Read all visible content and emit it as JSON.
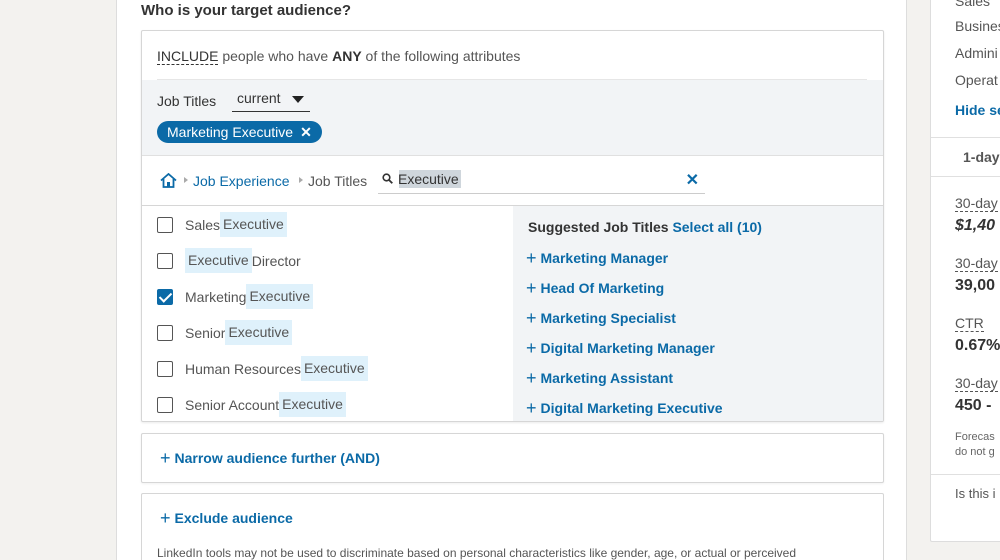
{
  "section_title": "Who is your target audience?",
  "include": {
    "prefix": "INCLUDE",
    "middle": " people who have ",
    "emphasis": "ANY",
    "suffix": " of the following attributes"
  },
  "job_titles": {
    "label": "Job Titles",
    "select_value": "current",
    "selected_pill": "Marketing Executive",
    "pill_remove_icon": "✕"
  },
  "breadcrumb": {
    "home_icon": "home-icon",
    "items": [
      "Job Experience",
      "Job Titles"
    ]
  },
  "search": {
    "value": "Executive",
    "clear_icon": "✕"
  },
  "results": [
    {
      "before": "Sales ",
      "match": "Executive",
      "after": "",
      "checked": false
    },
    {
      "before": "",
      "match": "Executive",
      "after": " Director",
      "checked": false
    },
    {
      "before": "Marketing ",
      "match": "Executive",
      "after": "",
      "checked": true
    },
    {
      "before": "Senior ",
      "match": "Executive",
      "after": "",
      "checked": false
    },
    {
      "before": "Human Resources ",
      "match": "Executive",
      "after": "",
      "checked": false
    },
    {
      "before": "Senior Account ",
      "match": "Executive",
      "after": "",
      "checked": false
    }
  ],
  "suggested": {
    "heading": "Suggested Job Titles",
    "select_all": "Select all (10)",
    "items": [
      "Marketing Manager",
      "Head Of Marketing",
      "Marketing Specialist",
      "Digital Marketing Manager",
      "Marketing Assistant",
      "Digital Marketing Executive"
    ]
  },
  "narrow_label": "Narrow audience further (AND)",
  "exclude_label": "Exclude audience",
  "disclaimer": "LinkedIn tools may not be used to discriminate based on personal characteristics like gender, age, or actual or perceived",
  "right_panel": {
    "list": [
      "Sales",
      "Busines",
      "Admini",
      "Operat"
    ],
    "hide_link": "Hide se",
    "tab": "1-day",
    "metric1_label": "30-day",
    "metric1_value": "$1,40",
    "metric2_label": "30-day",
    "metric2_value": "39,00",
    "metric3_label": "CTR",
    "metric3_value": "0.67%",
    "metric4_label": "30-day",
    "metric4_value": "450 -",
    "forecast_line1": "Forecas",
    "forecast_line2": "do not g",
    "question": "Is this i"
  },
  "colors": {
    "accent": "#0b6aa7",
    "highlight": "#dff1fb"
  }
}
